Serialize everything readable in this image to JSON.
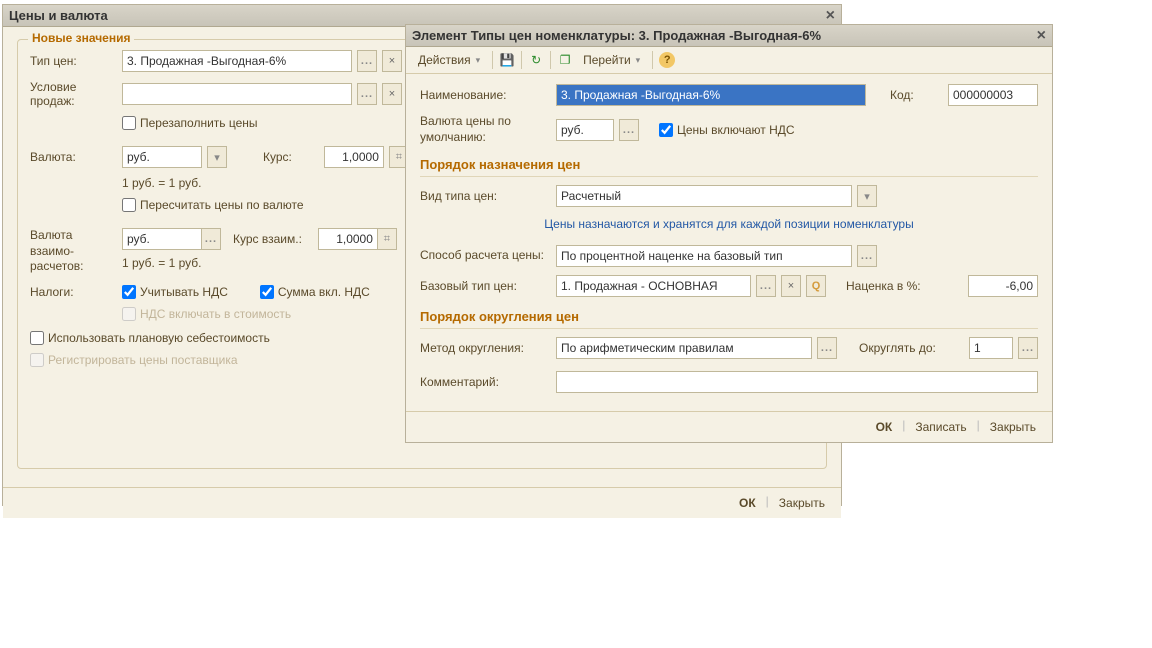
{
  "back_window": {
    "title": "Цены и валюта",
    "legend": "Новые значения",
    "price_type_label": "Тип цен:",
    "price_type_value": "3. Продажная -Выгодная-6%",
    "sale_cond_label": "Условие продаж:",
    "refill_label": "Перезаполнить цены",
    "currency_label": "Валюта:",
    "currency_value": "руб.",
    "rate_label": "Курс:",
    "rate_value": "1,0000",
    "rate_hint": "1 руб. = 1 руб.",
    "recalc_label": "Пересчитать цены по валюте",
    "settle_currency_label": "Валюта взаимо-расчетов:",
    "settle_currency_value": "руб.",
    "settle_rate_label": "Курс взаим.:",
    "settle_rate_value": "1,0000",
    "settle_hint": "1 руб. = 1 руб.",
    "taxes_label": "Налоги:",
    "vat_label": "Учитывать НДС",
    "sum_incl_label": "Сумма вкл. НДС",
    "vat_in_cost": "НДС включать в стоимость",
    "use_plan_cost": "Использовать плановую себестоимость",
    "register_supplier": "Регистрировать цены поставщика",
    "ok": "ОК",
    "close": "Закрыть"
  },
  "front_window": {
    "title": "Элемент Типы цен номенклатуры: 3. Продажная -Выгодная-6%",
    "actions": "Действия",
    "goto": "Перейти",
    "name_label": "Наименование:",
    "name_value": "3. Продажная -Выгодная-6%",
    "code_label": "Код:",
    "code_value": "000000003",
    "default_currency_label": "Валюта цены по умолчанию:",
    "default_currency_value": "руб.",
    "prices_include_vat": "Цены включают НДС",
    "pricing_header": "Порядок назначения цен",
    "price_type_kind_label": "Вид типа цен:",
    "price_type_kind_value": "Расчетный",
    "pricing_hint": "Цены назначаются и хранятся для каждой позиции номенклатуры",
    "calc_method_label": "Способ расчета цены:",
    "calc_method_value": "По процентной наценке на базовый тип",
    "base_type_label": "Базовый тип цен:",
    "base_type_value": "1. Продажная - ОСНОВНАЯ",
    "markup_label": "Наценка в %:",
    "markup_value": "-6,00",
    "rounding_header": "Порядок округления цен",
    "round_method_label": "Метод округления:",
    "round_method_value": "По арифметическим правилам",
    "round_to_label": "Округлять до:",
    "round_to_value": "1",
    "comment_label": "Комментарий:",
    "ok": "ОК",
    "save": "Записать",
    "close": "Закрыть"
  }
}
